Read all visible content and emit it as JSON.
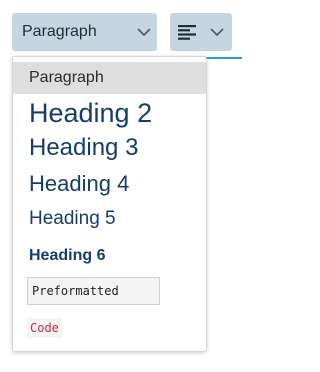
{
  "toolbar": {
    "format_select": {
      "selected_label": "Paragraph",
      "chevron_icon": "chevron-down-icon"
    },
    "align_button": {
      "icon": "align-left-icon",
      "chevron_icon": "chevron-down-icon"
    }
  },
  "format_menu": {
    "items": [
      {
        "label": "Paragraph",
        "format": "p",
        "selected": true
      },
      {
        "label": "Heading 2",
        "format": "h2"
      },
      {
        "label": "Heading 3",
        "format": "h3"
      },
      {
        "label": "Heading 4",
        "format": "h4"
      },
      {
        "label": "Heading 5",
        "format": "h5"
      },
      {
        "label": "Heading 6",
        "format": "h6"
      },
      {
        "label": "Preformatted",
        "format": "pre"
      },
      {
        "label": "Code",
        "format": "code"
      }
    ]
  },
  "colors": {
    "button_bg": "#c6d6e0",
    "heading_text": "#153e6e",
    "selected_bg": "#dedede",
    "code_text": "#c7254e",
    "accent_line": "#1aa3d6"
  }
}
